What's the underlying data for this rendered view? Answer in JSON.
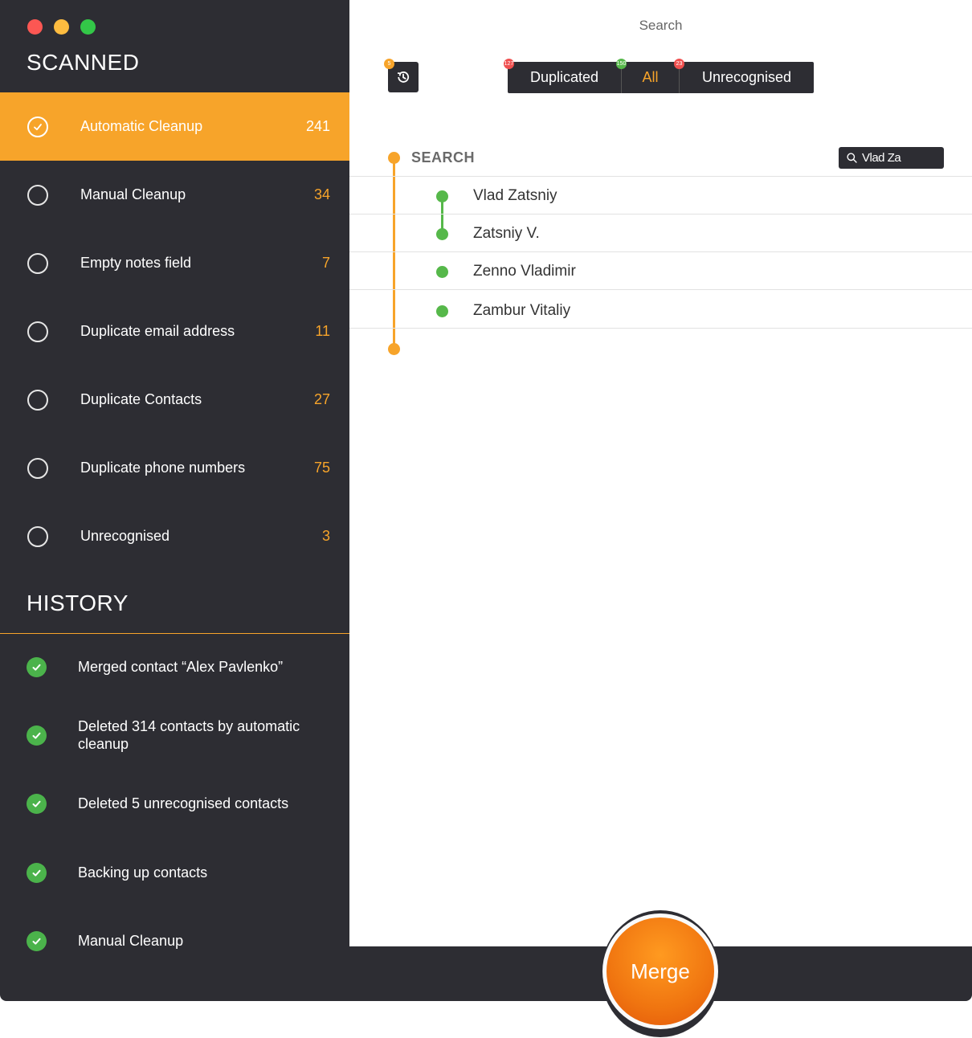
{
  "window": {
    "title": "Search"
  },
  "sidebar": {
    "scanned_title": "SCANNED",
    "items": [
      {
        "label": "Automatic Cleanup",
        "count": "241",
        "active": true
      },
      {
        "label": "Manual Cleanup",
        "count": "34",
        "active": false
      },
      {
        "label": "Empty notes field",
        "count": "7",
        "active": false
      },
      {
        "label": "Duplicate email address",
        "count": "11",
        "active": false
      },
      {
        "label": "Duplicate Contacts",
        "count": "27",
        "active": false
      },
      {
        "label": "Duplicate phone numbers",
        "count": "75",
        "active": false
      },
      {
        "label": "Unrecognised",
        "count": "3",
        "active": false
      }
    ],
    "history_title": "HISTORY",
    "history": [
      {
        "label": "Merged contact “Alex Pavlenko”"
      },
      {
        "label": "Deleted 314 contacts by automatic cleanup"
      },
      {
        "label": "Deleted 5 unrecognised contacts"
      },
      {
        "label": "Backing up contacts"
      },
      {
        "label": "Manual Cleanup"
      }
    ]
  },
  "toolbar": {
    "history_badge": "5",
    "segments": [
      {
        "label": "Duplicated",
        "badge": "127"
      },
      {
        "label": "All",
        "badge": "150"
      },
      {
        "label": "Unrecognised",
        "badge": "23"
      }
    ],
    "selected_segment": "All"
  },
  "search": {
    "label": "SEARCH",
    "query": "Vlad Za",
    "results": [
      {
        "name": "Vlad Zatsniy"
      },
      {
        "name": "Zatsniy V."
      },
      {
        "name": "Zenno Vladimir"
      },
      {
        "name": "Zambur Vitaliy"
      }
    ]
  },
  "footer": {
    "merge_label": "Merge"
  },
  "colors": {
    "accent": "#f7a42a",
    "sidebar_bg": "#2d2d33",
    "success": "#4bb34b",
    "badge_red": "#f05050"
  },
  "icons": {
    "history": "history-icon",
    "search": "search-icon",
    "check": "check-icon"
  }
}
